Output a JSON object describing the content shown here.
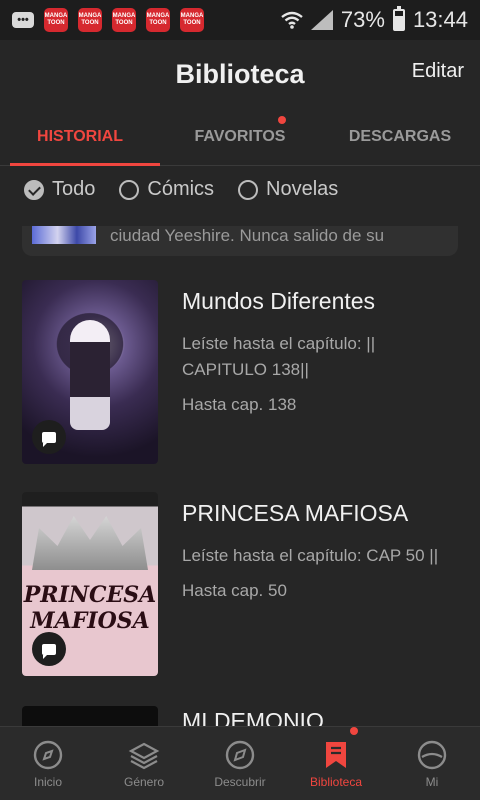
{
  "status_bar": {
    "app_icon_label": "MANGA TOON",
    "battery": "73%",
    "time": "13:44"
  },
  "header": {
    "title": "Biblioteca",
    "edit_label": "Editar"
  },
  "tabs": [
    {
      "label": "HISTORIAL",
      "active": true
    },
    {
      "label": "FAVORITOS",
      "active": false
    },
    {
      "label": "DESCARGAS",
      "active": false
    }
  ],
  "filters": [
    {
      "label": "Todo",
      "checked": true
    },
    {
      "label": "Cómics",
      "checked": false
    },
    {
      "label": "Novelas",
      "checked": false
    }
  ],
  "partial_item": {
    "text": "ciudad Yeeshire. Nunca salido de su"
  },
  "items": [
    {
      "title": "Mundos Diferentes",
      "progress": "Leíste hasta el capítulo: || CAPITULO 138||",
      "chapter": "Hasta cap. 138"
    },
    {
      "title": "PRINCESA MAFIOSA",
      "progress": "Leíste hasta el capítulo: CAP 50 ||",
      "chapter": "Hasta cap. 50",
      "cover_text": "PRINCESA MAFIOSA"
    }
  ],
  "third_item": {
    "title": "MI DEMONIO"
  },
  "bottom_nav": [
    {
      "label": "Inicio",
      "icon": "compass-icon",
      "active": false
    },
    {
      "label": "Género",
      "icon": "layers-icon",
      "active": false
    },
    {
      "label": "Descubrir",
      "icon": "compass-icon",
      "active": false
    },
    {
      "label": "Biblioteca",
      "icon": "bookmark-icon",
      "active": true
    },
    {
      "label": "Mi",
      "icon": "face-icon",
      "active": false
    }
  ],
  "colors": {
    "accent": "#f0463f",
    "background": "#262626"
  }
}
